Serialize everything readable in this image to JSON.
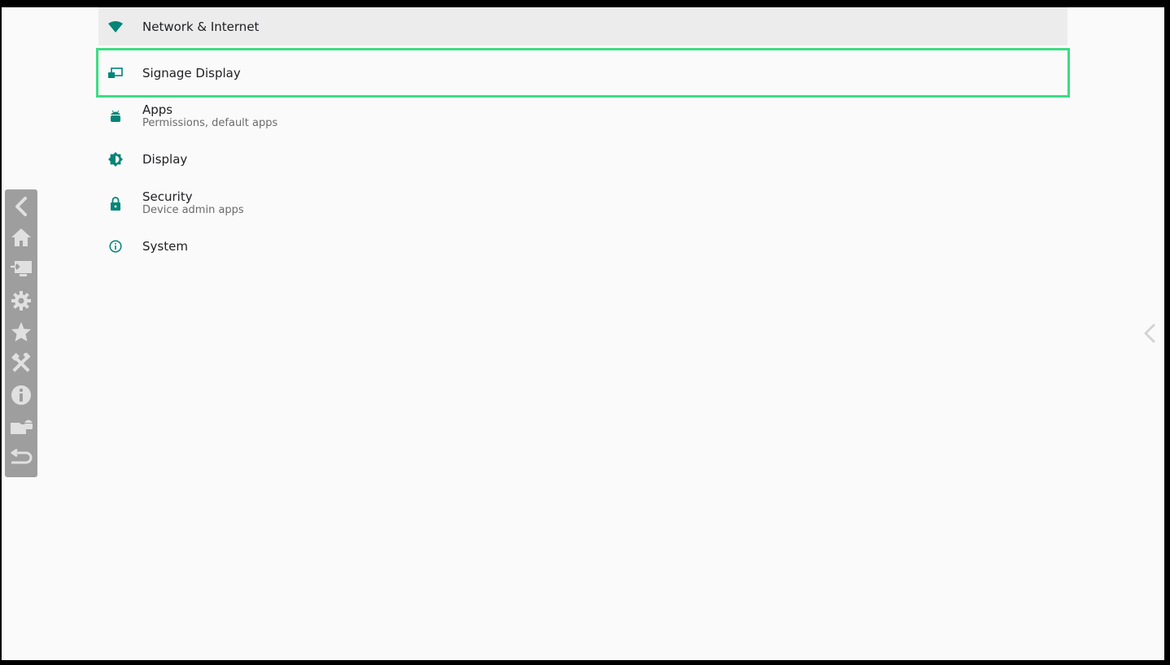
{
  "colors": {
    "accent": "#008577",
    "highlight_border": "#3ddc84",
    "selected_row_bg": "#ececec",
    "sidebar_bg": "#9e9e9e",
    "sidebar_icon": "#e0e0e0"
  },
  "settings": {
    "network": {
      "title": "Network & Internet",
      "icon": "wifi-icon"
    },
    "signage": {
      "title": "Signage Display",
      "icon": "signage-display-icon"
    },
    "apps": {
      "title": "Apps",
      "subtitle": "Permissions, default apps",
      "icon": "android-icon"
    },
    "display": {
      "title": "Display",
      "icon": "brightness-icon"
    },
    "security": {
      "title": "Security",
      "subtitle": "Device admin apps",
      "icon": "lock-icon"
    },
    "system": {
      "title": "System",
      "icon": "info-icon"
    }
  },
  "sidebar": {
    "items": [
      {
        "icon": "back-chevron-icon"
      },
      {
        "icon": "home-icon"
      },
      {
        "icon": "input-source-icon"
      },
      {
        "icon": "settings-gear-icon"
      },
      {
        "icon": "star-icon"
      },
      {
        "icon": "tools-icon"
      },
      {
        "icon": "info-icon"
      },
      {
        "icon": "apps-folder-icon"
      },
      {
        "icon": "return-icon"
      }
    ]
  },
  "edge_handle": {
    "icon": "chevron-left-icon"
  }
}
